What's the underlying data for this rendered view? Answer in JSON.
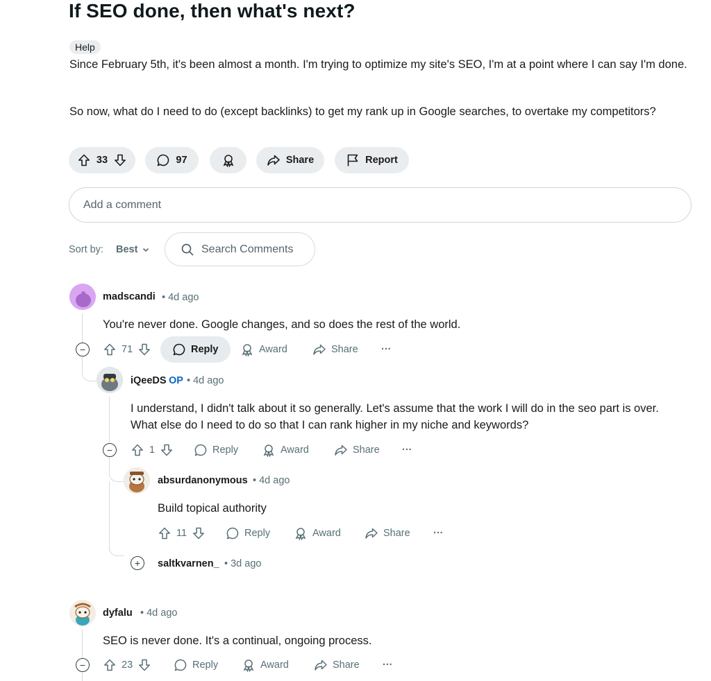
{
  "post": {
    "title": "If SEO done, then what's next?",
    "flair": "Help",
    "paragraph1": "Since February 5th, it's been almost a month. I'm trying to optimize my site's SEO, I'm at a point where I can say I'm done.",
    "paragraph2": "So now, what do I need to do (except backlinks) to get my rank up in Google searches, to overtake my competitors?",
    "votes": "33",
    "comments": "97",
    "share_label": "Share",
    "report_label": "Report"
  },
  "comment_box": {
    "placeholder": "Add a comment"
  },
  "sort": {
    "label": "Sort by:",
    "value": "Best"
  },
  "search": {
    "placeholder": "Search Comments"
  },
  "labels": {
    "reply": "Reply",
    "award": "Award",
    "share": "Share",
    "more": "···"
  },
  "comments": [
    {
      "username": "madscandi",
      "time": "• 4d ago",
      "text": "You're never done. Google changes, and so does the rest of the world.",
      "votes": "71",
      "avatar_color": "#d49ef0"
    },
    {
      "username": "iQeeDS",
      "op": "OP",
      "time": "• 4d ago",
      "text": "I understand, I didn't talk about it so generally. Let's assume that the work I will do in the seo part is over. What else do I need to do so that I can rank higher in my niche and keywords?",
      "votes": "1"
    },
    {
      "username": "absurdanonymous",
      "time": "• 4d ago",
      "text": "Build topical authority",
      "votes": "11"
    },
    {
      "username": "saltkvarnen_",
      "time": "• 3d ago"
    },
    {
      "username": "dyfalu",
      "time": "• 4d ago",
      "text": "SEO is never done. It's a continual, ongoing process.",
      "votes": "23"
    }
  ]
}
